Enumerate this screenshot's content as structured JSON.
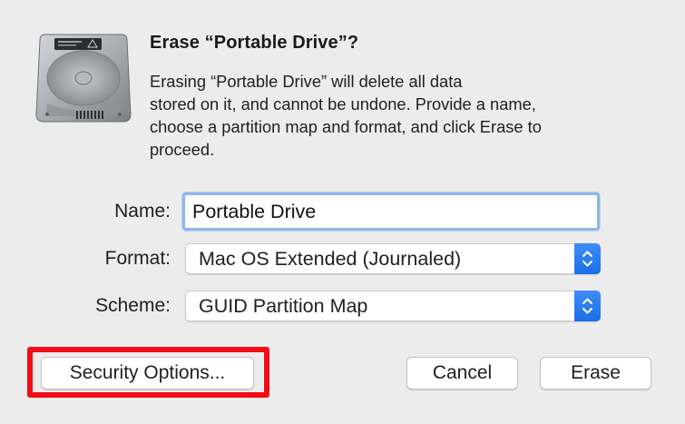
{
  "dialog": {
    "title": "Erase “Portable Drive”?",
    "message_lines": [
      "Erasing “Portable Drive” will delete all data",
      "stored on it, and cannot be undone. Provide a name,",
      "choose a partition map and format, and click Erase to",
      "proceed."
    ],
    "icon": "hard-drive-icon"
  },
  "form": {
    "name_label": "Name:",
    "name_value": "Portable Drive",
    "format_label": "Format:",
    "format_value": "Mac OS Extended (Journaled)",
    "scheme_label": "Scheme:",
    "scheme_value": "GUID Partition Map"
  },
  "buttons": {
    "security_options": "Security Options...",
    "cancel": "Cancel",
    "erase": "Erase"
  },
  "colors": {
    "highlight": "#f20d16",
    "accent": "#1a6fe8",
    "focus_ring": "#8fb6ea",
    "background": "#ececec"
  }
}
